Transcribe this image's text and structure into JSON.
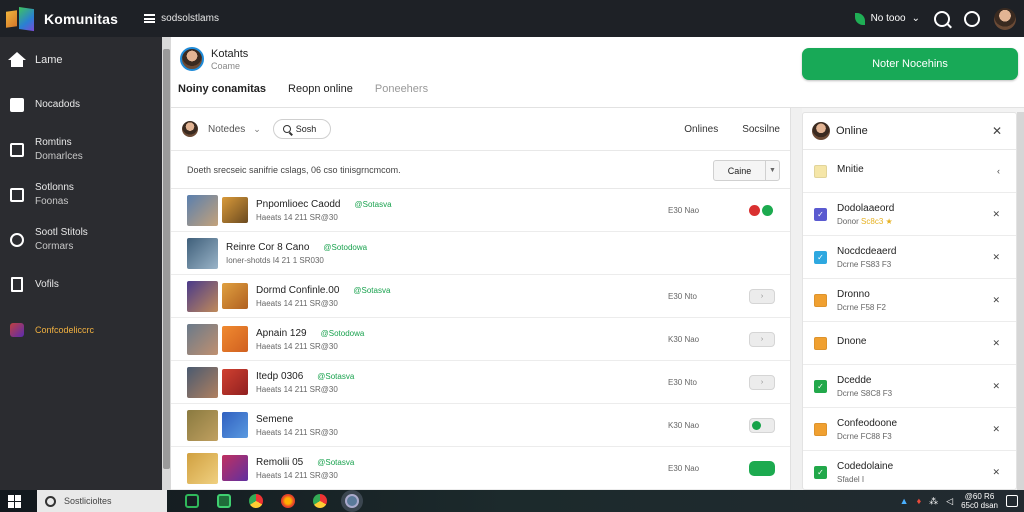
{
  "app": {
    "title": "Komunitas",
    "menu_label": "sodsolstlams",
    "status_label": "No tooo",
    "colors": {
      "accent": "#18a957",
      "topbar": "#1e2126",
      "sidebar": "#2b2c30"
    }
  },
  "sidebar": {
    "items": [
      {
        "icon": "home-icon",
        "label": "Lame",
        "label2": ""
      },
      {
        "icon": "checkbox-icon",
        "label": "Nocadods",
        "label2": ""
      },
      {
        "icon": "list-icon",
        "label": "Romtins",
        "label2": "Domarlces"
      },
      {
        "icon": "megaphone-icon",
        "label": "Sotlonns",
        "label2": "Foonas"
      },
      {
        "icon": "chat-icon",
        "label": "Sootl Stitols",
        "label2": "Cormars"
      },
      {
        "icon": "document-icon",
        "label": "Vofils",
        "label2": ""
      },
      {
        "icon": "game-thumbnail-icon",
        "label": "Confcodeliccrc",
        "label2": ""
      }
    ]
  },
  "header": {
    "profile_name": "Kotahts",
    "profile_sub": "Coame",
    "tabs": [
      {
        "label": "Noiny conamitas",
        "state": "active"
      },
      {
        "label": "Reopn online",
        "state": "normal"
      },
      {
        "label": "Poneehers",
        "state": "dim"
      }
    ],
    "primary_button": "Noter Nocehins"
  },
  "filters": {
    "dropdown_label": "Notedes",
    "search_label": "Sosh",
    "right_labels": [
      "Onlines",
      "Socsilne"
    ]
  },
  "subbar": {
    "text": "Doeth srecseic sanifrie cslags, 06 cso tinisgrncmcom.",
    "sort_value": "Caine"
  },
  "list": {
    "rows": [
      {
        "title": "Pnpomlioec Caodd",
        "tag": "@Sotasva",
        "sub": "Haeats 14 211 SR@30",
        "time": "E30 Nao",
        "control": "dots",
        "thumb1": [
          "#5a7fae",
          "#c4a27a"
        ],
        "thumb2": [
          "#d99a3a",
          "#6b4a20"
        ]
      },
      {
        "title": "Reinre Cor 8 Cano",
        "tag": "@Sotodowa",
        "sub": "Ioner-shotds I4 21 1 SR030",
        "time": "",
        "control": "none",
        "thumb1": [
          "#3f5f7a",
          "#9ab4c8"
        ],
        "thumb2": null
      },
      {
        "title": "Dormd Confinle.00",
        "tag": "@Sotasva",
        "sub": "Haeats 14 211 SR@30",
        "time": "E30 Nto",
        "control": "grey",
        "thumb1": [
          "#4a3a8a",
          "#c08a5a"
        ],
        "thumb2": [
          "#e0a040",
          "#b06020"
        ]
      },
      {
        "title": "Apnain 129",
        "tag": "@Sotodowa",
        "sub": "Haeats 14 211 SR@30",
        "time": "K30 Nao",
        "control": "grey",
        "thumb1": [
          "#6a7a8a",
          "#c09070"
        ],
        "thumb2": [
          "#f08a30",
          "#d06020"
        ]
      },
      {
        "title": "Itedp 0306",
        "tag": "@Sotasva",
        "sub": "Haeats 14 211 SR@30",
        "time": "E30 Nto",
        "control": "grey",
        "thumb1": [
          "#4a5a70",
          "#b08060"
        ],
        "thumb2": [
          "#d04030",
          "#902020"
        ]
      },
      {
        "title": "Semene",
        "tag": "",
        "sub": "Haeats 14 211 SR@30",
        "time": "K30 Nao",
        "control": "toggle",
        "thumb1": [
          "#8a7a40",
          "#c0a060"
        ],
        "thumb2": [
          "#3060c0",
          "#5a9ae0"
        ]
      },
      {
        "title": "Remolii 05",
        "tag": "@Sotasva",
        "sub": "Haeats 14 211 SR@30",
        "time": "E30 Nao",
        "control": "green",
        "thumb1": [
          "#d0a040",
          "#f0d080"
        ],
        "thumb2": [
          "#c03060",
          "#6030a0"
        ]
      }
    ]
  },
  "online_panel": {
    "title": "Online",
    "items": [
      {
        "name": "Mnitie",
        "sub": "",
        "star": "",
        "check_color": "#f5e6a8",
        "mark": ""
      },
      {
        "name": "Dodolaaeord",
        "sub": "Donor",
        "star": "Sc8c3 ★",
        "check_color": "#5a5ad0",
        "mark": "✓"
      },
      {
        "name": "Nocdcdeaerd",
        "sub": "Dcrne FS83 F3",
        "star": "",
        "check_color": "#2ea8e0",
        "mark": "✓"
      },
      {
        "name": "Dronno",
        "sub": "Dcrne F58 F2",
        "star": "",
        "check_color": "#f0a030",
        "mark": ""
      },
      {
        "name": "Dnone",
        "sub": "",
        "star": "",
        "check_color": "#f0a030",
        "mark": ""
      },
      {
        "name": "Dcedde",
        "sub": "Dcrne S8C8 F3",
        "star": "",
        "check_color": "#22a84a",
        "mark": "✓"
      },
      {
        "name": "Confeodoone",
        "sub": "Dcrne FC88 F3",
        "star": "",
        "check_color": "#f0a030",
        "mark": ""
      },
      {
        "name": "Codedolaine",
        "sub": "Sfadel I",
        "star": "",
        "check_color": "#22a84a",
        "mark": "✓"
      }
    ]
  },
  "taskbar": {
    "search_label": "Sostlicioltes",
    "clock_line1": "@60 R6",
    "clock_line2": "65c0 dsan"
  }
}
